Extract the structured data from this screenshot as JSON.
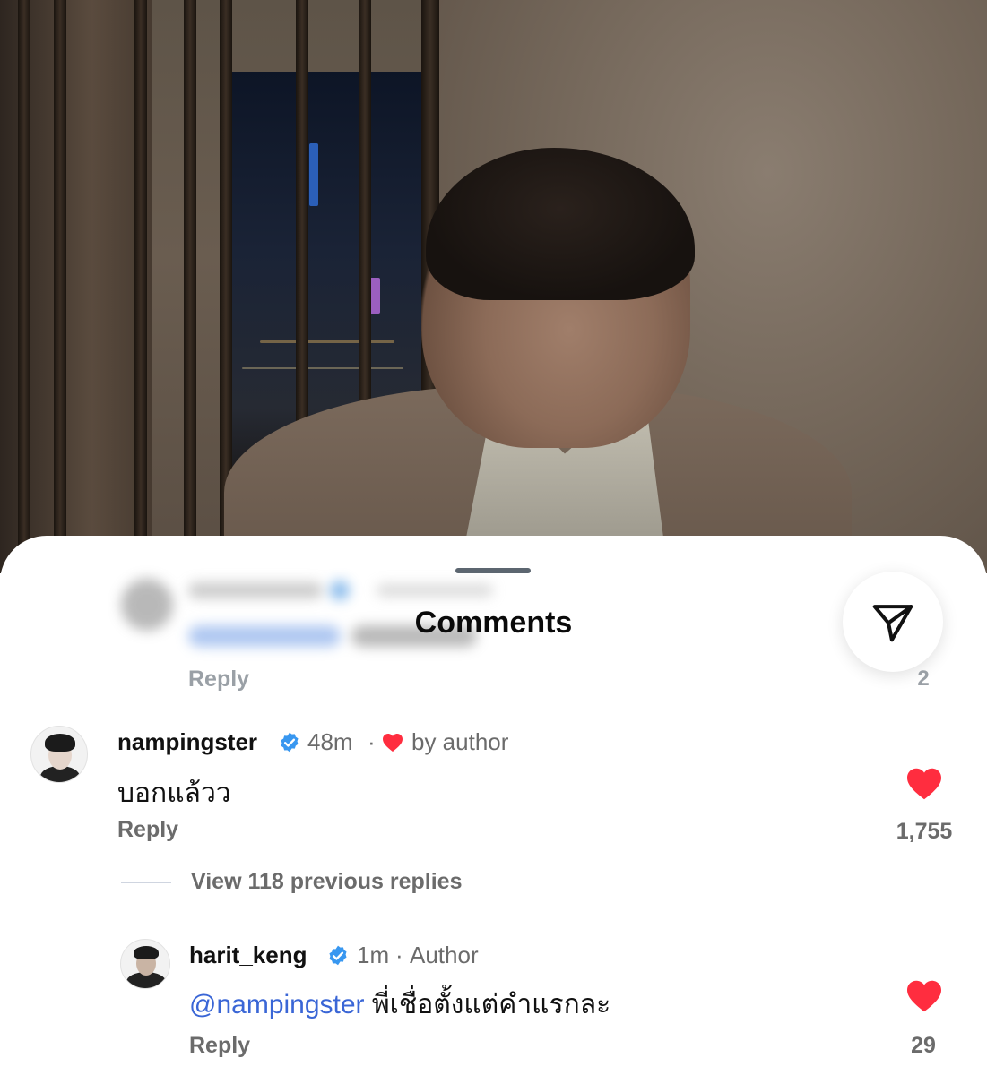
{
  "sheet": {
    "title": "Comments",
    "previous_comment": {
      "reply_label": "Reply",
      "like_count": "2"
    }
  },
  "comments": [
    {
      "username": "nampingster",
      "verified": true,
      "time": "48m",
      "badge": "by author",
      "text": "บอกแล้วว",
      "reply_label": "Reply",
      "liked": true,
      "like_count": "1,755"
    }
  ],
  "thread": {
    "view_previous_label": "View 118 previous replies"
  },
  "replies": [
    {
      "username": "harit_keng",
      "verified": true,
      "time": "1m",
      "badge": "Author",
      "mention": "@nampingster",
      "text": "พี่เชื่อตั้งแต่คำแรกละ",
      "reply_label": "Reply",
      "liked": true,
      "like_count": "29"
    }
  ],
  "colors": {
    "heart": "#ff2d3f",
    "verified": "#3897f0",
    "mention": "#3a66d6"
  },
  "icons": {
    "share": "share-paper-plane-icon",
    "like": "heart-filled-icon",
    "verified": "verified-badge-icon"
  }
}
